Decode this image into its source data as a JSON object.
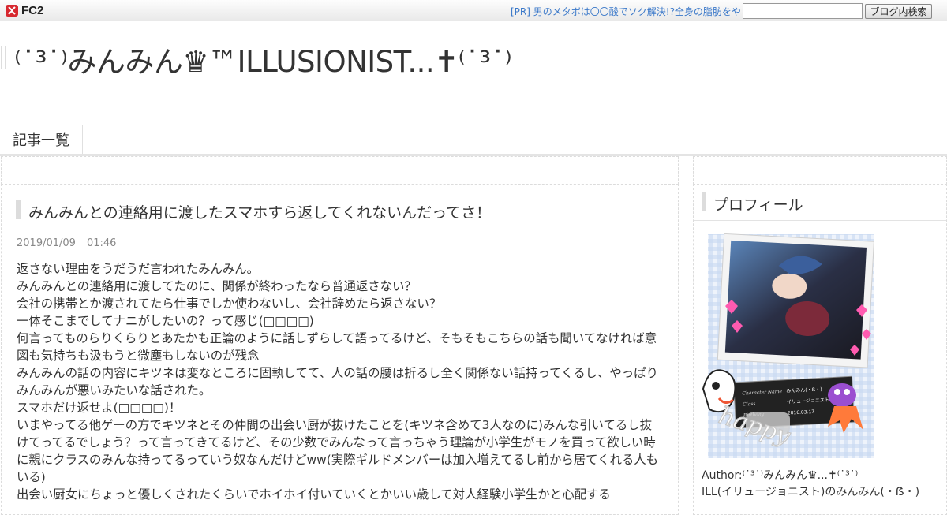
{
  "fc2": {
    "logo_text": "FC2",
    "pr_link": "[PR] 男のメタボは〇〇酸でソク解決!?全身の脂肪をや",
    "search_value": "",
    "search_button": "ブログ内検索"
  },
  "blog": {
    "title": "⁽˙³˙⁾みんみん♛™ILLUSIONIST...✝⁽˙³˙⁾"
  },
  "nav": {
    "items": [
      "記事一覧"
    ]
  },
  "entry": {
    "title": "みんみんとの連絡用に渡したスマホすら返してくれないんだってさ！",
    "date": "2019/01/09",
    "time": "01:46",
    "lines": [
      "返さない理由をうだうだ言われたみんみん。",
      "みんみんとの連絡用に渡してたのに、関係が終わったなら普通返さない？",
      "会社の携帯とか渡されてたら仕事でしか使わないし、会社辞めたら返さない？",
      "一体そこまでしてナニがしたいの？って感じ(□□□□)",
      "何言ってものらりくらりとあたかも正論のように話しずらして語ってるけど、そもそもこちらの話も聞いてなければ意図も気持ちも汲もうと微塵もしないのが残念",
      "みんみんの話の内容にキツネは変なところに固執してて、人の話の腰は折るし全く関係ない話持ってくるし、やっぱりみんみんが悪いみたいな話された。",
      "スマホだけ返せよ(□□□□)！",
      "いまやってる他ゲーの方でキツネとその仲間の出会い厨が抜けたことを(キツネ含めて3人なのに)みんな引いてるし抜けてってるでしょう？って言ってきてるけど、その少数でみんなって言っちゃう理論が小学生がモノを買って欲しい時に親にクラスのみんな持ってるっていう奴なんだけどww(実際ギルドメンバーは加入増えてるし前から居てくれる人もいる)",
      "出会い厨女にちょっと優しくされたくらいでホイホイ付いていくとかいい歳して対人経験小学生かと心配する"
    ]
  },
  "sidebar": {
    "profile_title": "プロフィール",
    "author_label": "Author:⁽˙³˙⁾みんみん♛...✝⁽˙³˙⁾",
    "author_desc": "ILL(イリュージョニスト)のみんみん(・ẞ・)",
    "card_name_label": "Character Name",
    "card_name": "みんみん(・ẞ・)",
    "card_class_label": "Class",
    "card_class": "イリュージョニスト",
    "card_birth_label": "Birthday",
    "card_birth": "2016.03.17",
    "sticker_text": "happy"
  },
  "colors": {
    "link": "#3a78c9",
    "fc2_red": "#d7282f"
  }
}
